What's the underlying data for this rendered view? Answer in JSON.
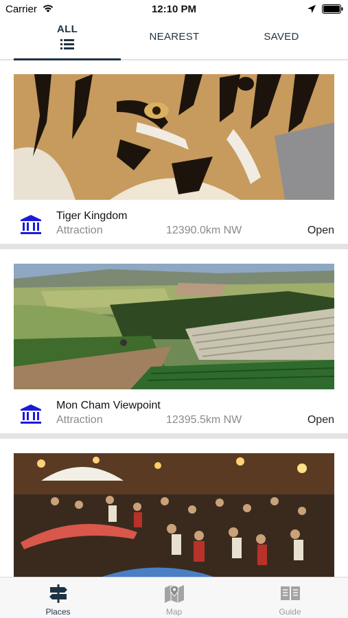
{
  "status_bar": {
    "carrier": "Carrier",
    "time": "12:10 PM"
  },
  "tabs": [
    {
      "label": "ALL",
      "active": true,
      "icon": "list-icon"
    },
    {
      "label": "NEAREST",
      "active": false
    },
    {
      "label": "SAVED",
      "active": false
    }
  ],
  "places": [
    {
      "title": "Tiger Kingdom",
      "category": "Attraction",
      "distance": "12390.0km NW",
      "status": "Open",
      "icon": "museum-icon",
      "image": "tiger-photo"
    },
    {
      "title": "Mon Cham Viewpoint",
      "category": "Attraction",
      "distance": "12395.5km NW",
      "status": "Open",
      "icon": "museum-icon",
      "image": "hillside-farm-photo"
    },
    {
      "title": "",
      "category": "",
      "distance": "",
      "status": "",
      "icon": "",
      "image": "night-market-photo"
    }
  ],
  "tabbar": [
    {
      "label": "Places",
      "icon": "signpost-icon",
      "active": true
    },
    {
      "label": "Map",
      "icon": "map-icon",
      "active": false
    },
    {
      "label": "Guide",
      "icon": "book-icon",
      "active": false
    }
  ],
  "colors": {
    "accent": "#1f3243",
    "icon_blue": "#1a1adb",
    "separator": "#e3e3e3",
    "muted_text": "#8a8a8a"
  }
}
